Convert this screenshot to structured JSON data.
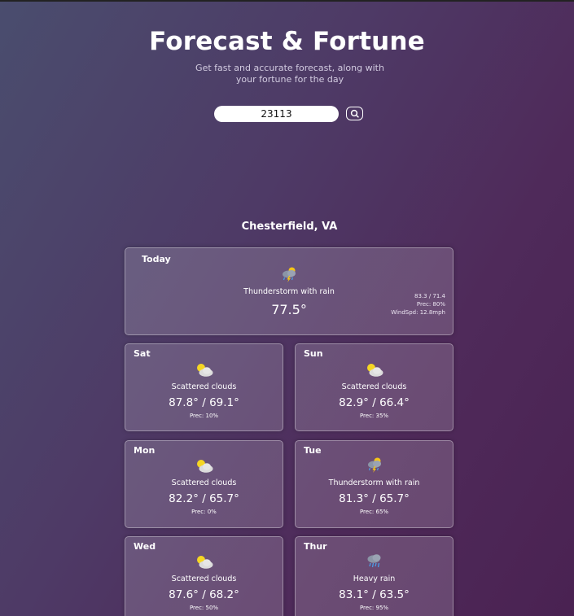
{
  "header": {
    "title": "Forecast & Fortune",
    "subtitle": "Get fast and accurate forecast, along with your fortune for the day"
  },
  "search": {
    "value": "23113",
    "icon": "search-icon"
  },
  "location": "Chesterfield, VA",
  "today": {
    "day": "Today",
    "icon": "thunderstorm-icon",
    "condition": "Thunderstorm with rain",
    "temp": "77.5°",
    "hilo": "83.3 / 71.4",
    "prec": "Prec: 80%",
    "wind": "WindSpd: 12.8mph"
  },
  "days": [
    {
      "day": "Sat",
      "icon": "partly-cloudy-icon",
      "condition": "Scattered clouds",
      "temps": "87.8° / 69.1°",
      "prec": "Prec: 10%"
    },
    {
      "day": "Sun",
      "icon": "partly-cloudy-icon",
      "condition": "Scattered clouds",
      "temps": "82.9° / 66.4°",
      "prec": "Prec: 35%"
    },
    {
      "day": "Mon",
      "icon": "partly-cloudy-icon",
      "condition": "Scattered clouds",
      "temps": "82.2° / 65.7°",
      "prec": "Prec: 0%"
    },
    {
      "day": "Tue",
      "icon": "thunderstorm-icon",
      "condition": "Thunderstorm with rain",
      "temps": "81.3° / 65.7°",
      "prec": "Prec: 65%"
    },
    {
      "day": "Wed",
      "icon": "partly-cloudy-icon",
      "condition": "Scattered clouds",
      "temps": "87.6° / 68.2°",
      "prec": "Prec: 50%"
    },
    {
      "day": "Thur",
      "icon": "heavy-rain-icon",
      "condition": "Heavy rain",
      "temps": "83.1° / 63.5°",
      "prec": "Prec: 95%"
    }
  ]
}
